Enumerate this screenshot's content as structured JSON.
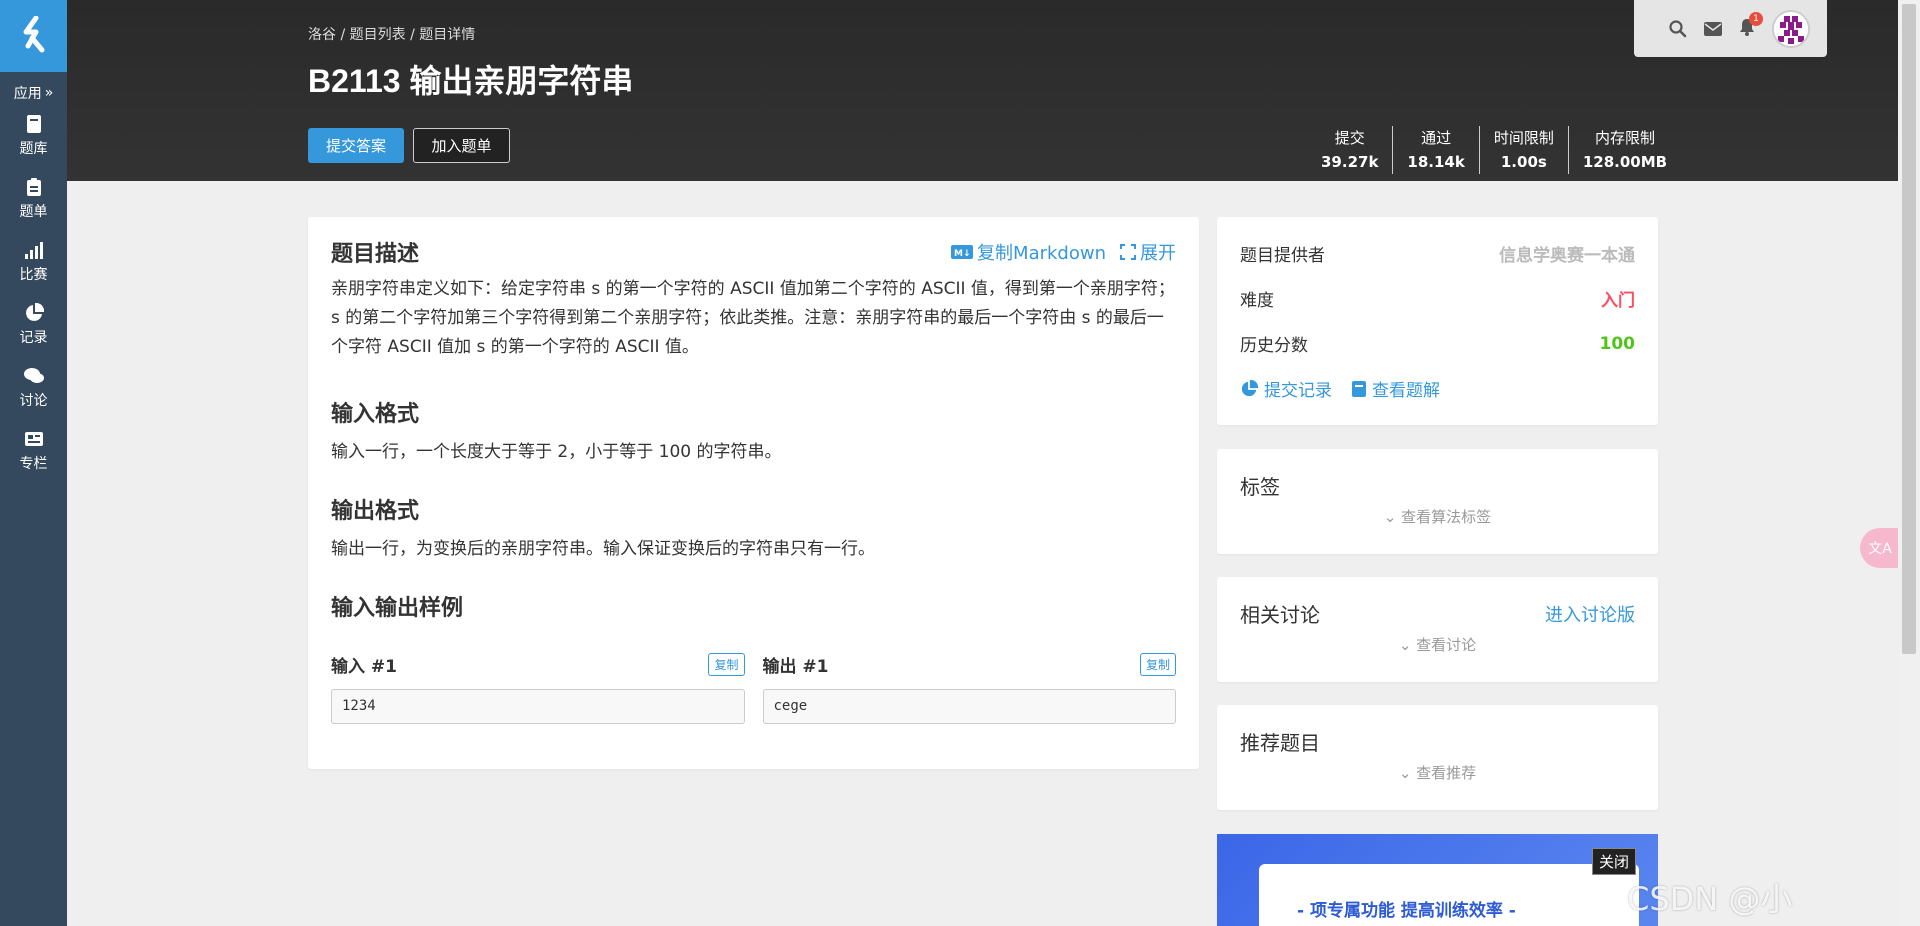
{
  "sidebar": {
    "apps_label": "应用",
    "items": [
      {
        "label": "题库"
      },
      {
        "label": "题单"
      },
      {
        "label": "比赛"
      },
      {
        "label": "记录"
      },
      {
        "label": "讨论"
      },
      {
        "label": "专栏"
      }
    ]
  },
  "header": {
    "breadcrumb": "洛谷 / 题目列表 / 题目详情",
    "title": "B2113 输出亲朋字符串",
    "submit_label": "提交答案",
    "add_list_label": "加入题单",
    "stats": [
      {
        "label": "提交",
        "value": "39.27k"
      },
      {
        "label": "通过",
        "value": "18.14k"
      },
      {
        "label": "时间限制",
        "value": "1.00s"
      },
      {
        "label": "内存限制",
        "value": "128.00MB"
      }
    ],
    "notification_count": "1"
  },
  "problem": {
    "desc_title": "题目描述",
    "copy_markdown": "复制Markdown",
    "expand": "展开",
    "description": "亲朋字符串定义如下：给定字符串 s 的第一个字符的 ASCII 值加第二个字符的 ASCII 值，得到第一个亲朋字符；s 的第二个字符加第三个字符得到第二个亲朋字符；依此类推。注意：亲朋字符串的最后一个字符由 s 的最后一个字符 ASCII 值加 s 的第一个字符的 ASCII 值。",
    "input_title": "输入格式",
    "input_text": "输入一行，一个长度大于等于 2，小于等于 100 的字符串。",
    "output_title": "输出格式",
    "output_text": "输出一行，为变换后的亲朋字符串。输入保证变换后的字符串只有一行。",
    "samples_title": "输入输出样例",
    "sample_input_label": "输入 #1",
    "sample_output_label": "输出 #1",
    "copy_label": "复制",
    "sample_input": "1234",
    "sample_output": "cege"
  },
  "info": {
    "provider_label": "题目提供者",
    "provider_value": "信息学奥赛一本通",
    "difficulty_label": "难度",
    "difficulty_value": "入门",
    "history_label": "历史分数",
    "history_value": "100",
    "submissions_link": "提交记录",
    "solutions_link": "查看题解"
  },
  "tags": {
    "title": "标签",
    "more": "查看算法标签"
  },
  "discuss": {
    "title": "相关讨论",
    "enter": "进入讨论版",
    "more": "查看讨论"
  },
  "recommend": {
    "title": "推荐题目",
    "more": "查看推荐"
  },
  "ad": {
    "text": "- 项专属功能 提高训练效率 -",
    "close": "关闭"
  },
  "watermark": "CSDN @小",
  "colors": {
    "brand": "#3498db",
    "sidebar": "#34495e",
    "difficulty": "#fe4c61",
    "score": "#52c41a"
  }
}
